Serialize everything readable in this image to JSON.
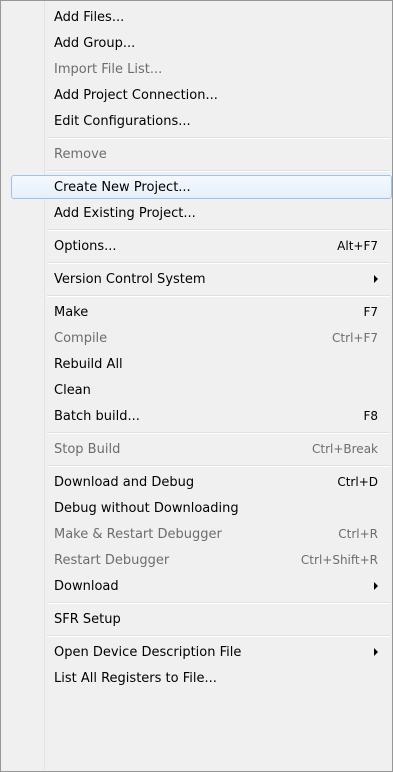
{
  "menu": {
    "items": [
      {
        "label": "Add Files...",
        "enabled": true
      },
      {
        "label": "Add Group...",
        "enabled": true
      },
      {
        "label": "Import File List...",
        "enabled": false
      },
      {
        "label": "Add Project Connection...",
        "enabled": true
      },
      {
        "label": "Edit Configurations...",
        "enabled": true
      },
      {
        "label": "Remove",
        "enabled": false
      },
      {
        "label": "Create New Project...",
        "enabled": true,
        "highlighted": true
      },
      {
        "label": "Add Existing Project...",
        "enabled": true
      },
      {
        "label": "Options...",
        "shortcut": "Alt+F7",
        "enabled": true
      },
      {
        "label": "Version Control System",
        "enabled": true,
        "submenu": true
      },
      {
        "label": "Make",
        "shortcut": "F7",
        "enabled": true
      },
      {
        "label": "Compile",
        "shortcut": "Ctrl+F7",
        "enabled": false
      },
      {
        "label": "Rebuild All",
        "enabled": true
      },
      {
        "label": "Clean",
        "enabled": true
      },
      {
        "label": "Batch build...",
        "shortcut": "F8",
        "enabled": true
      },
      {
        "label": "Stop Build",
        "shortcut": "Ctrl+Break",
        "enabled": false
      },
      {
        "label": "Download and Debug",
        "shortcut": "Ctrl+D",
        "enabled": true
      },
      {
        "label": "Debug without Downloading",
        "enabled": true
      },
      {
        "label": "Make & Restart Debugger",
        "shortcut": "Ctrl+R",
        "enabled": false
      },
      {
        "label": "Restart Debugger",
        "shortcut": "Ctrl+Shift+R",
        "enabled": false
      },
      {
        "label": "Download",
        "enabled": true,
        "submenu": true
      },
      {
        "label": "SFR Setup",
        "enabled": true
      },
      {
        "label": "Open Device Description File",
        "enabled": true,
        "submenu": true
      },
      {
        "label": "List All Registers to File...",
        "enabled": true
      }
    ]
  }
}
